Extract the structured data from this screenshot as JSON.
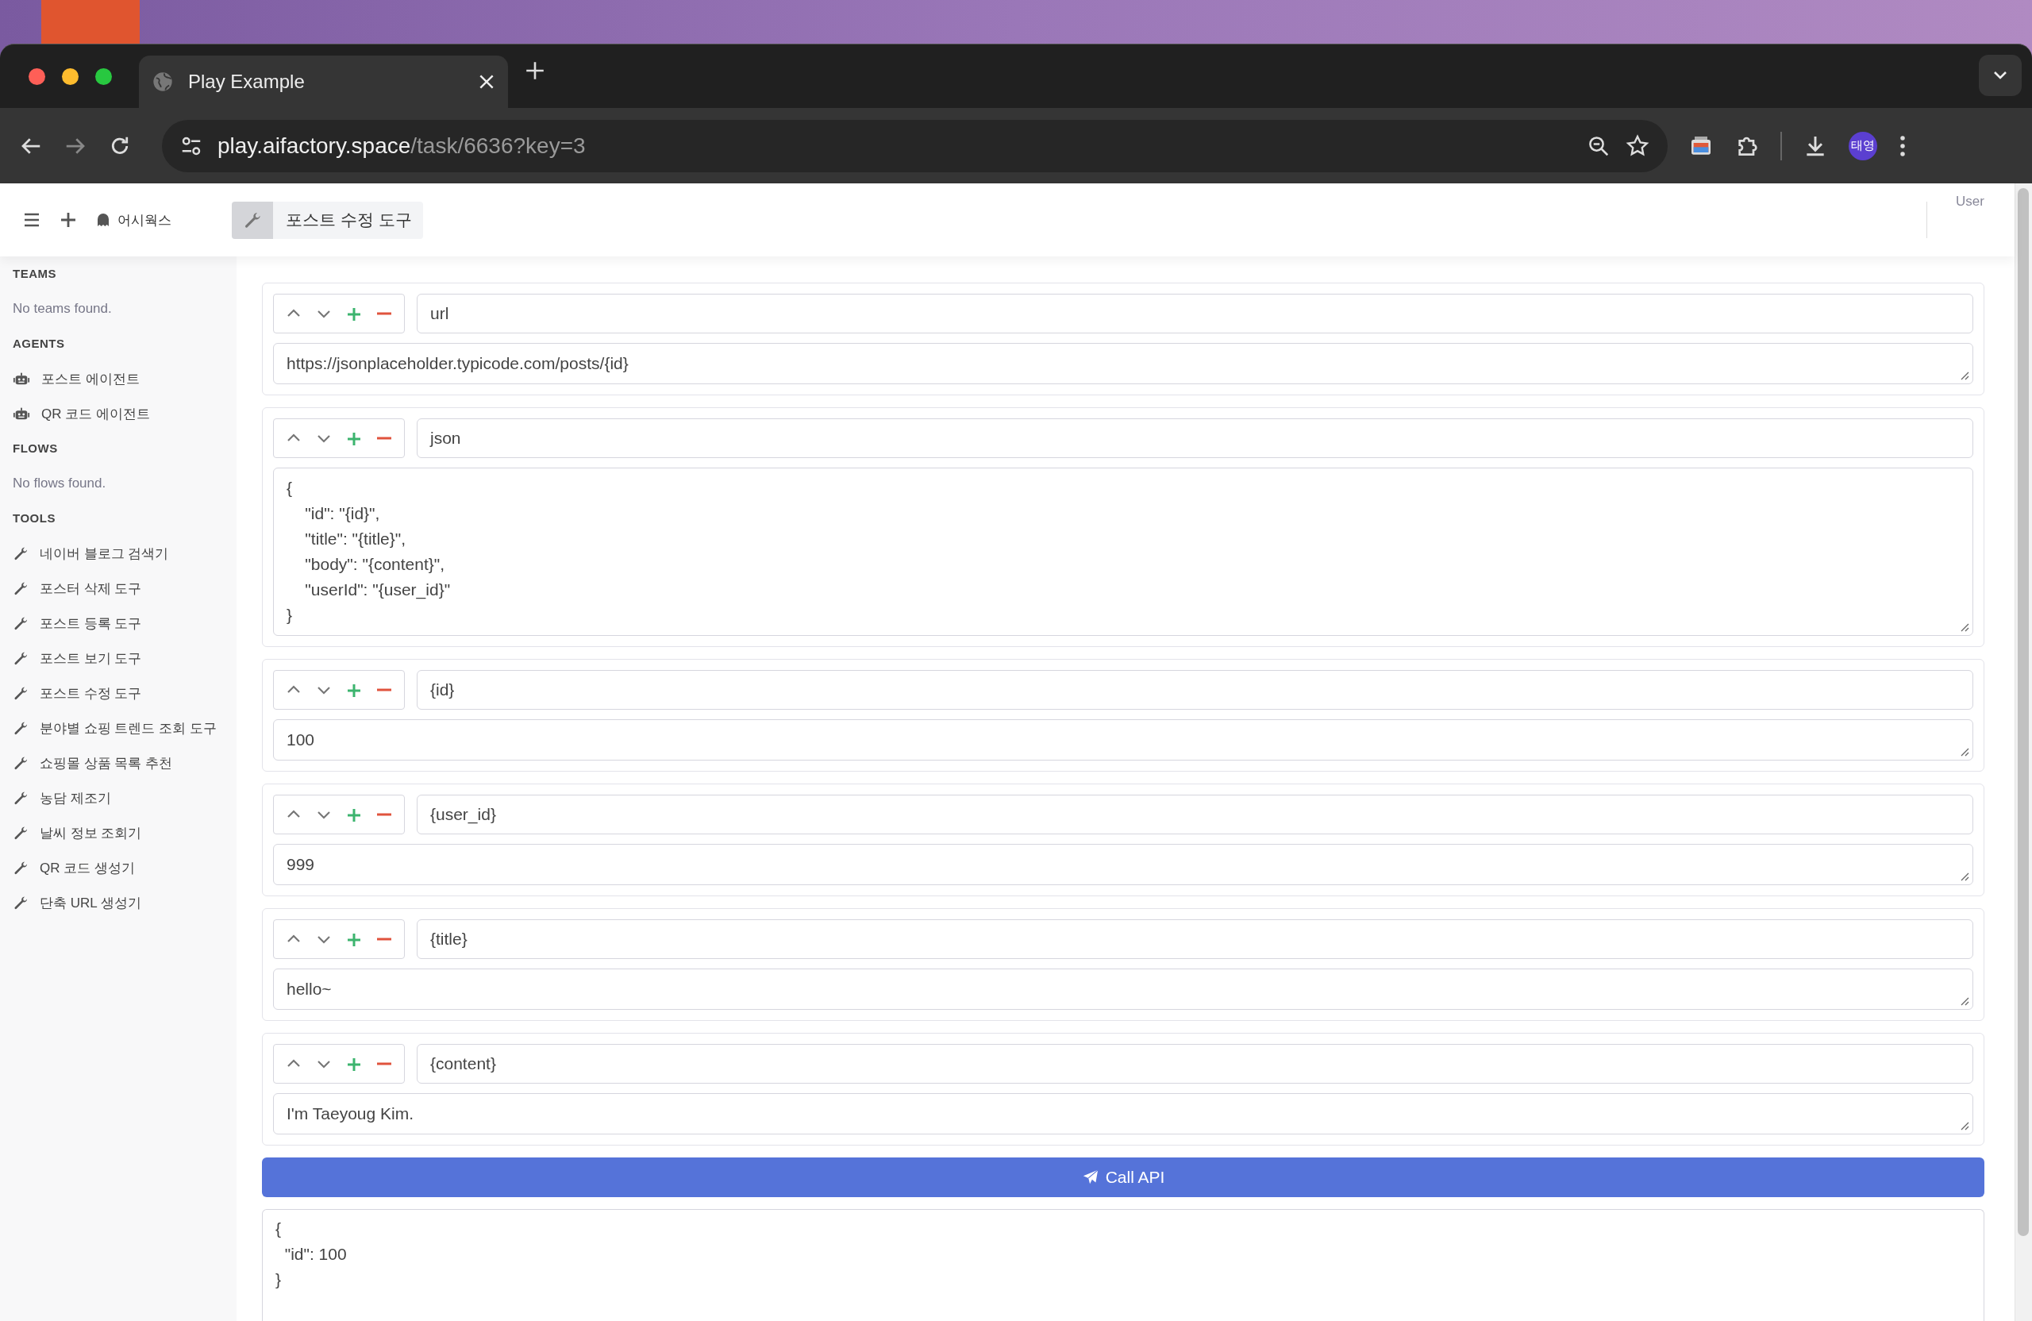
{
  "browser": {
    "tabs": [
      {
        "title": "Play Example",
        "selected": true
      }
    ],
    "address": {
      "host": "play.aifactory.space",
      "path": "/task/6636?key=3"
    },
    "profile": "태영"
  },
  "app": {
    "workspace": "어시웍스",
    "open_tool": "포스트 수정 도구",
    "user": "User"
  },
  "sidebar": {
    "sections": [
      {
        "title": "TEAMS",
        "empty": "No teams found."
      },
      {
        "title": "AGENTS",
        "items": [
          {
            "label": "포스트 에이전트",
            "kind": "agent",
            "selected": false
          },
          {
            "label": "QR 코드 에이전트",
            "kind": "agent",
            "selected": false
          }
        ]
      },
      {
        "title": "FLOWS",
        "empty": "No flows found."
      },
      {
        "title": "TOOLS",
        "items": [
          {
            "label": "네이버 블로그 검색기",
            "kind": "tool",
            "selected": false
          },
          {
            "label": "포스터 삭제 도구",
            "kind": "tool",
            "selected": false
          },
          {
            "label": "포스트 등록 도구",
            "kind": "tool",
            "selected": false
          },
          {
            "label": "포스트 보기 도구",
            "kind": "tool",
            "selected": false
          },
          {
            "label": "포스트 수정 도구",
            "kind": "tool",
            "selected": false
          },
          {
            "label": "분야별 쇼핑 트렌드 조회 도구",
            "kind": "tool",
            "selected": false
          },
          {
            "label": "쇼핑몰 상품 목록 추천",
            "kind": "tool",
            "selected": false
          },
          {
            "label": "농담 제조기",
            "kind": "tool",
            "selected": false
          },
          {
            "label": "날씨 정보 조회기",
            "kind": "tool",
            "selected": false
          },
          {
            "label": "QR 코드 생성기",
            "kind": "tool",
            "selected": false
          },
          {
            "label": "단축 URL 생성기",
            "kind": "tool",
            "selected": false
          }
        ]
      }
    ]
  },
  "params": [
    {
      "key": "url",
      "value": "https://jsonplaceholder.typicode.com/posts/{id}"
    },
    {
      "key": "json",
      "value": "{\n    \"id\": \"{id}\",\n    \"title\": \"{title}\",\n    \"body\": \"{content}\",\n    \"userId\": \"{user_id}\"\n}"
    },
    {
      "key": "{id}",
      "value": "100"
    },
    {
      "key": "{user_id}",
      "value": "999"
    },
    {
      "key": "{title}",
      "value": "hello~"
    },
    {
      "key": "{content}",
      "value": "I'm Taeyoug Kim."
    }
  ],
  "call_button": "Call API",
  "result": "{\n  \"id\": 100\n}"
}
